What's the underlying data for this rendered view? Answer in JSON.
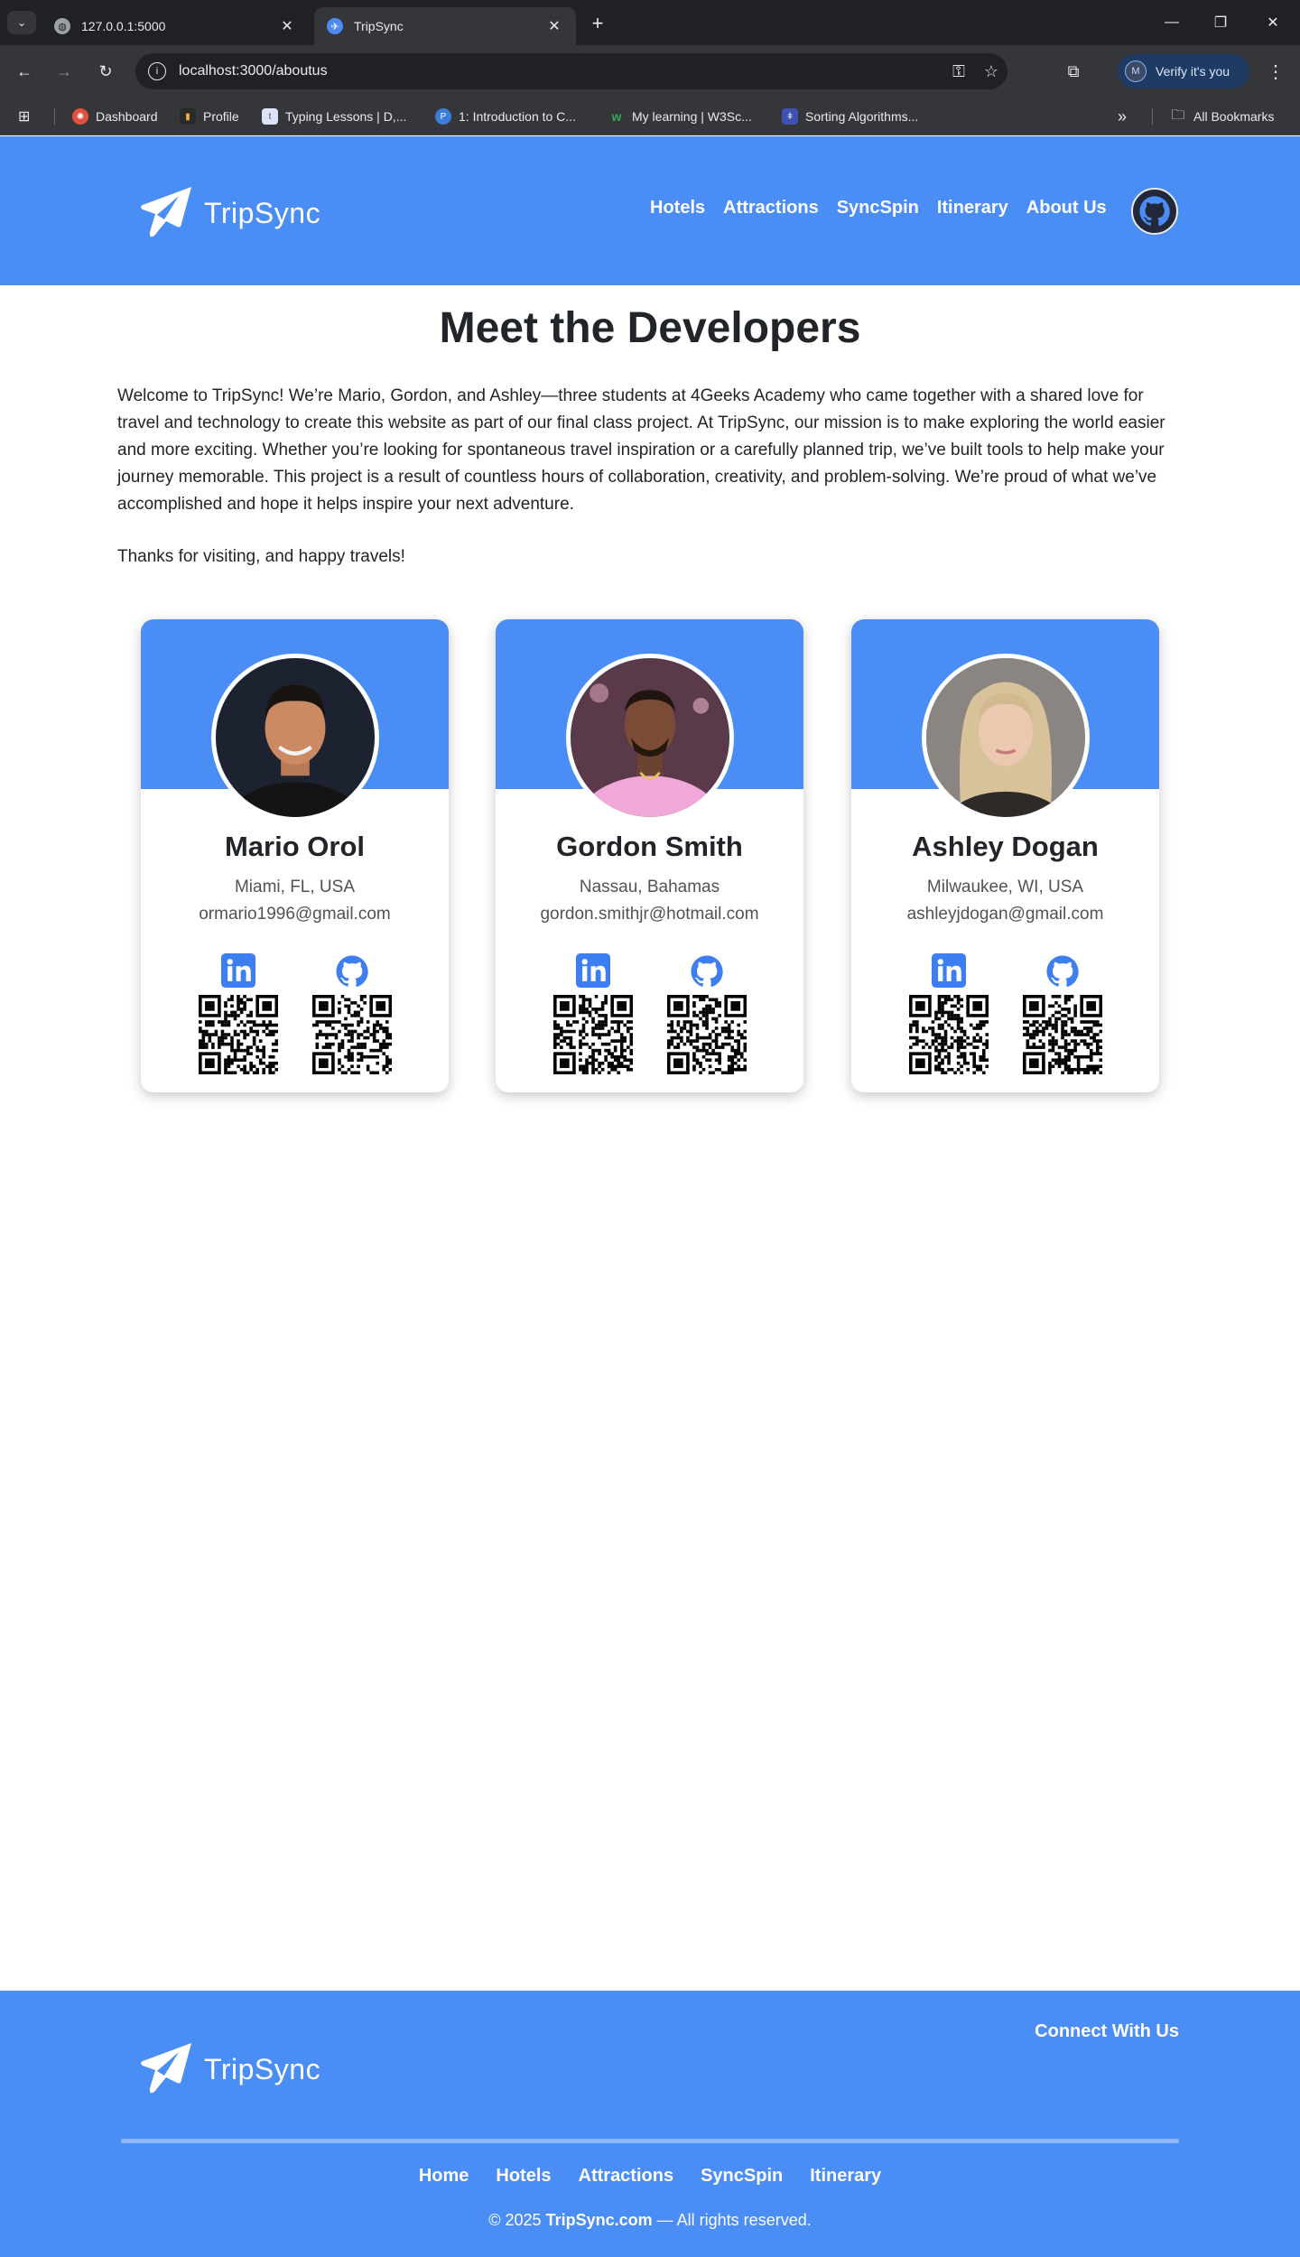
{
  "browser": {
    "tabs": [
      {
        "title": "127.0.0.1:5000",
        "active": false
      },
      {
        "title": "TripSync",
        "active": true
      }
    ],
    "url": "localhost:3000/aboutus",
    "verify_label": "Verify it's you",
    "verify_avatar_letter": "M",
    "bookmarks": [
      {
        "label": "Dashboard",
        "color": "#e0523f"
      },
      {
        "label": "Profile",
        "color": "#f2b233"
      },
      {
        "label": "Typing Lessons | D,...",
        "color": "#5b7bd5"
      },
      {
        "label": "1: Introduction to C...",
        "color": "#3b7dd8"
      },
      {
        "label": "My learning | W3Sc...",
        "color": "#3ca55c"
      },
      {
        "label": "Sorting Algorithms...",
        "color": "#3f51b5"
      }
    ],
    "all_bookmarks_label": "All Bookmarks"
  },
  "brand": {
    "name": "TripSync",
    "color": "#4a8df5"
  },
  "nav": {
    "items": [
      "Hotels",
      "Attractions",
      "SyncSpin",
      "Itinerary",
      "About Us"
    ]
  },
  "page": {
    "title": "Meet the Developers",
    "intro": "Welcome to TripSync! We’re Mario, Gordon, and Ashley—three students at 4Geeks Academy who came together with a shared love for travel and technology to create this website as part of our final class project. At TripSync, our mission is to make exploring the world easier and more exciting. Whether you’re looking for spontaneous travel inspiration or a carefully planned trip, we’ve built tools to help make your journey memorable. This project is a result of countless hours of collaboration, creativity, and problem-solving. We’re proud of what we’ve accomplished and hope it helps inspire your next adventure.",
    "thanks": "Thanks for visiting, and happy travels!"
  },
  "developers": [
    {
      "name": "Mario Orol",
      "location": "Miami, FL, USA",
      "email": "ormario1996@gmail.com"
    },
    {
      "name": "Gordon Smith",
      "location": "Nassau, Bahamas",
      "email": "gordon.smithjr@hotmail.com"
    },
    {
      "name": "Ashley Dogan",
      "location": "Milwaukee, WI, USA",
      "email": "ashleyjdogan@gmail.com"
    }
  ],
  "footer": {
    "connect_label": "Connect With Us",
    "links": [
      "Home",
      "Hotels",
      "Attractions",
      "SyncSpin",
      "Itinerary"
    ],
    "copyright_prefix": "© 2025",
    "copyright_brand": "TripSync.com",
    "copyright_suffix": "— All rights reserved."
  }
}
